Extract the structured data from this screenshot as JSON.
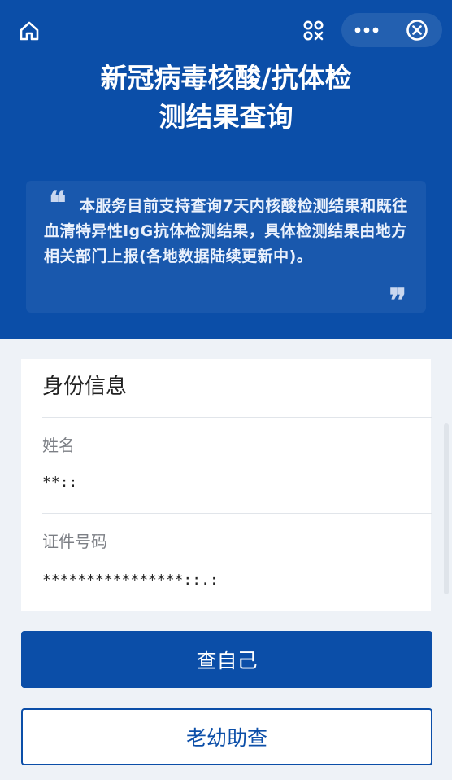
{
  "header": {
    "title_line1": "新冠病毒核酸/抗体检",
    "title_line2": "测结果查询",
    "icons": {
      "home": "home-icon",
      "qr": "qr-scan-icon",
      "more": "more-dots-icon",
      "close": "close-circle-icon"
    }
  },
  "notice": {
    "quote_open": "❝",
    "quote_close": "❞",
    "text": "本服务目前支持查询7天内核酸检测结果和既往血清特异性lgG抗体检测结果，具体检测结果由地方相关部门上报(各地数据陆续更新中)。"
  },
  "identity": {
    "section_title": "身份信息",
    "name_label": "姓名",
    "name_value": "**::",
    "id_label": "证件号码",
    "id_value": "****************::.:"
  },
  "actions": {
    "self_query": "查自己",
    "elderly_child_query": "老幼助查"
  },
  "colors": {
    "primary": "#0b4ea8",
    "background": "#eef2f7",
    "card": "#ffffff"
  }
}
